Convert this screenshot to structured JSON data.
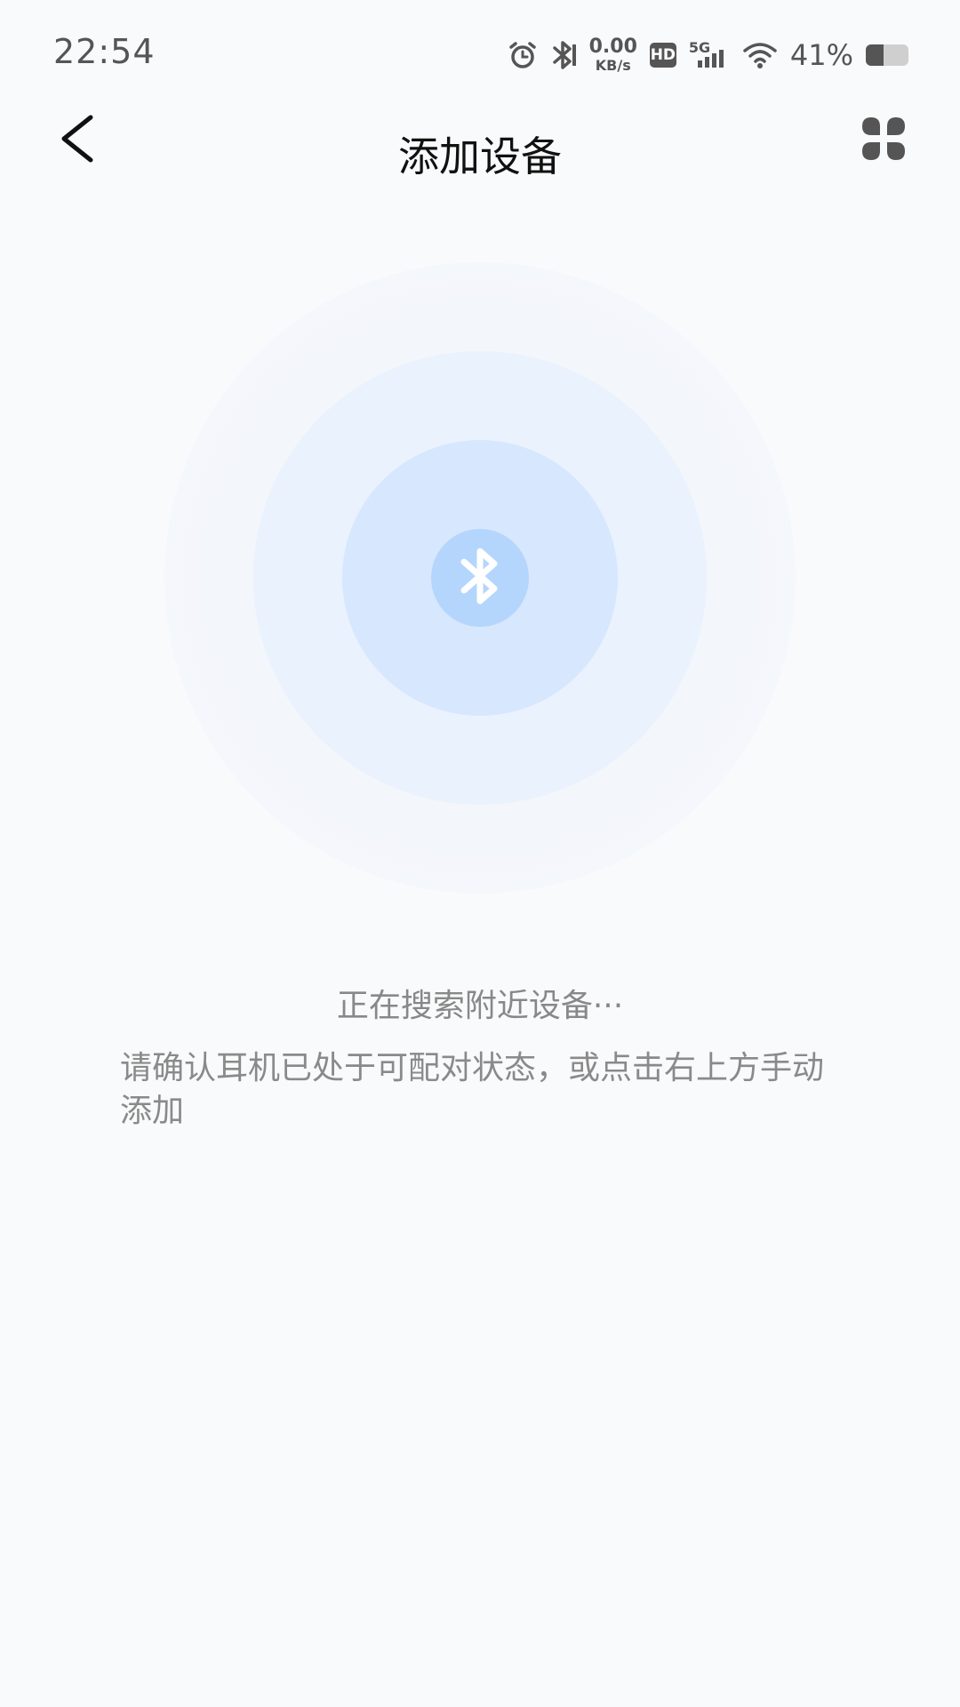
{
  "status_bar": {
    "time": "22:54",
    "speed_value": "0.00",
    "speed_unit": "KB/s",
    "hd_label": "HD",
    "network_label": "5G",
    "battery_percent_text": "41%",
    "battery_level": 0.41,
    "icons": [
      "alarm-icon",
      "bluetooth-icon",
      "hd-icon",
      "signal-5g-icon",
      "wifi-icon",
      "battery-icon"
    ]
  },
  "header": {
    "title": "添加设备",
    "back_icon": "chevron-left-icon",
    "menu_icon": "four-dots-menu-icon"
  },
  "radar": {
    "center_icon": "bluetooth-icon",
    "colors": {
      "outer": "#f3f6fb",
      "middle": "#eaf2fd",
      "inner": "#d7e7fd",
      "core": "#b4d6fc"
    }
  },
  "main": {
    "searching_text": "正在搜索附近设备···",
    "hint_text": "请确认耳机已处于可配对状态，或点击右上方手动添加"
  }
}
